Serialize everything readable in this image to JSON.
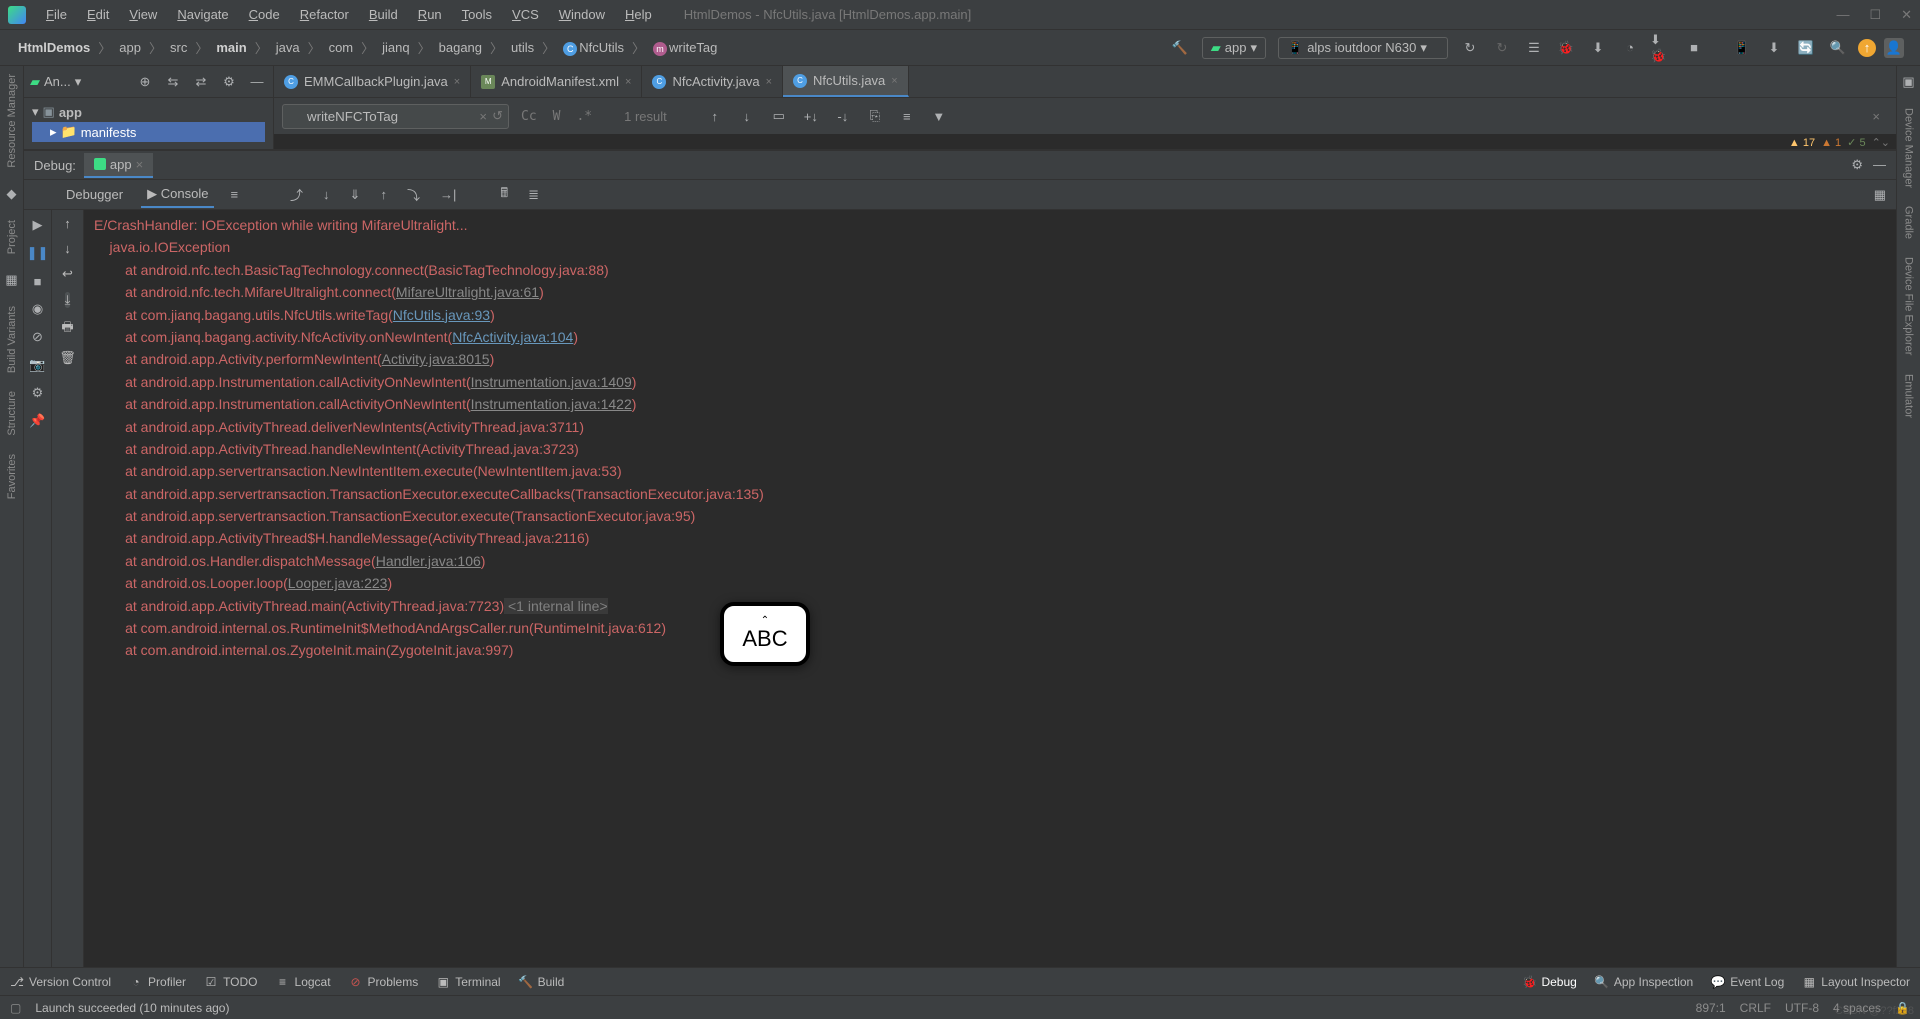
{
  "menubar": {
    "items": [
      "File",
      "Edit",
      "View",
      "Navigate",
      "Code",
      "Refactor",
      "Build",
      "Run",
      "Tools",
      "VCS",
      "Window",
      "Help"
    ],
    "title": "HtmlDemos - NfcUtils.java [HtmlDemos.app.main]"
  },
  "breadcrumbs": {
    "parts": [
      "HtmlDemos",
      "app",
      "src",
      "main",
      "java",
      "com",
      "jianq",
      "bagang",
      "utils",
      "NfcUtils",
      "writeTag"
    ]
  },
  "run_config": {
    "label": "app"
  },
  "device": {
    "label": "alps ioutdoor N630"
  },
  "project": {
    "selector": "An...",
    "root": "app",
    "child": "manifests"
  },
  "tabs": [
    {
      "label": "EMMCallbackPlugin.java",
      "icon": "c"
    },
    {
      "label": "AndroidManifest.xml",
      "icon": "mf"
    },
    {
      "label": "NfcActivity.java",
      "icon": "c"
    },
    {
      "label": "NfcUtils.java",
      "icon": "c",
      "active": true
    }
  ],
  "search": {
    "query": "writeNFCToTag",
    "opts": [
      "Cc",
      "W",
      ".*"
    ],
    "result": "1 result"
  },
  "inspections": {
    "warn": "17",
    "err": "1",
    "ok": "5"
  },
  "debug": {
    "label": "Debug:",
    "run_tab": "app",
    "tabs": [
      "Debugger",
      "Console"
    ],
    "active_tab": "Console"
  },
  "console_lines": [
    {
      "t": "err",
      "text": "E/CrashHandler: IOException while writing MifareUltralight..."
    },
    {
      "t": "err",
      "text": "    java.io.IOException"
    },
    {
      "t": "err",
      "prefix": "        at android.nfc.tech.BasicTagTechnology.connect(",
      "link": "BasicTagTechnology.java:88",
      "linkStyle": "plain",
      "suffix": ")"
    },
    {
      "t": "err",
      "prefix": "        at android.nfc.tech.MifareUltralight.connect(",
      "link": "MifareUltralight.java:61",
      "linkStyle": "dim",
      "suffix": ")"
    },
    {
      "t": "err",
      "prefix": "        at com.jianq.bagang.utils.NfcUtils.writeTag(",
      "link": "NfcUtils.java:93",
      "linkStyle": "blue",
      "suffix": ")"
    },
    {
      "t": "err",
      "prefix": "        at com.jianq.bagang.activity.NfcActivity.onNewIntent(",
      "link": "NfcActivity.java:104",
      "linkStyle": "blue",
      "suffix": ")"
    },
    {
      "t": "err",
      "prefix": "        at android.app.Activity.performNewIntent(",
      "link": "Activity.java:8015",
      "linkStyle": "dim",
      "suffix": ")"
    },
    {
      "t": "err",
      "prefix": "        at android.app.Instrumentation.callActivityOnNewIntent(",
      "link": "Instrumentation.java:1409",
      "linkStyle": "dim",
      "suffix": ")"
    },
    {
      "t": "err",
      "prefix": "        at android.app.Instrumentation.callActivityOnNewIntent(",
      "link": "Instrumentation.java:1422",
      "linkStyle": "dim",
      "suffix": ")"
    },
    {
      "t": "err",
      "prefix": "        at android.app.ActivityThread.deliverNewIntents(",
      "link": "ActivityThread.java:3711",
      "linkStyle": "plain",
      "suffix": ")"
    },
    {
      "t": "err",
      "prefix": "        at android.app.ActivityThread.handleNewIntent(",
      "link": "ActivityThread.java:3723",
      "linkStyle": "plain",
      "suffix": ")"
    },
    {
      "t": "err",
      "prefix": "        at android.app.servertransaction.NewIntentItem.execute(",
      "link": "NewIntentItem.java:53",
      "linkStyle": "plain",
      "suffix": ")"
    },
    {
      "t": "err",
      "prefix": "        at android.app.servertransaction.TransactionExecutor.executeCallbacks(",
      "link": "TransactionExecutor.java:135",
      "linkStyle": "plain",
      "suffix": ")"
    },
    {
      "t": "err",
      "prefix": "        at android.app.servertransaction.TransactionExecutor.execute(",
      "link": "TransactionExecutor.java:95",
      "linkStyle": "plain",
      "suffix": ")"
    },
    {
      "t": "err",
      "prefix": "        at android.app.ActivityThread$H.handleMessage(",
      "link": "ActivityThread.java:2116",
      "linkStyle": "plain",
      "suffix": ")"
    },
    {
      "t": "err",
      "prefix": "        at android.os.Handler.dispatchMessage(",
      "link": "Handler.java:106",
      "linkStyle": "dim",
      "suffix": ")"
    },
    {
      "t": "err",
      "prefix": "        at android.os.Looper.loop(",
      "link": "Looper.java:223",
      "linkStyle": "dim",
      "suffix": ")"
    },
    {
      "t": "err",
      "prefix": "        at android.app.ActivityThread.main(",
      "link": "ActivityThread.java:7723",
      "linkStyle": "plain",
      "suffix": ")",
      "tail": " <1 internal line>"
    },
    {
      "t": "err",
      "prefix": "        at com.android.internal.os.RuntimeInit$MethodAndArgsCaller.run(",
      "link": "RuntimeInit.java:612",
      "linkStyle": "plain",
      "suffix": ")"
    },
    {
      "t": "err",
      "prefix": "        at com.android.internal.os.ZygoteInit.main(",
      "link": "ZygoteInit.java:997",
      "linkStyle": "plain",
      "suffix": ")"
    }
  ],
  "bottom_tabs": {
    "left": [
      "Version Control",
      "Profiler",
      "TODO",
      "Logcat",
      "Problems",
      "Terminal",
      "Build"
    ],
    "active": "Debug",
    "right": [
      "App Inspection",
      "Event Log",
      "Layout Inspector"
    ]
  },
  "statusbar": {
    "msg": "Launch succeeded (10 minutes ago)",
    "pos": "897:1",
    "eol": "CRLF",
    "enc": "UTF-8",
    "indent": "4 spaces"
  },
  "ime": {
    "label": "ABC"
  },
  "watermark": "CSDN @??f298"
}
